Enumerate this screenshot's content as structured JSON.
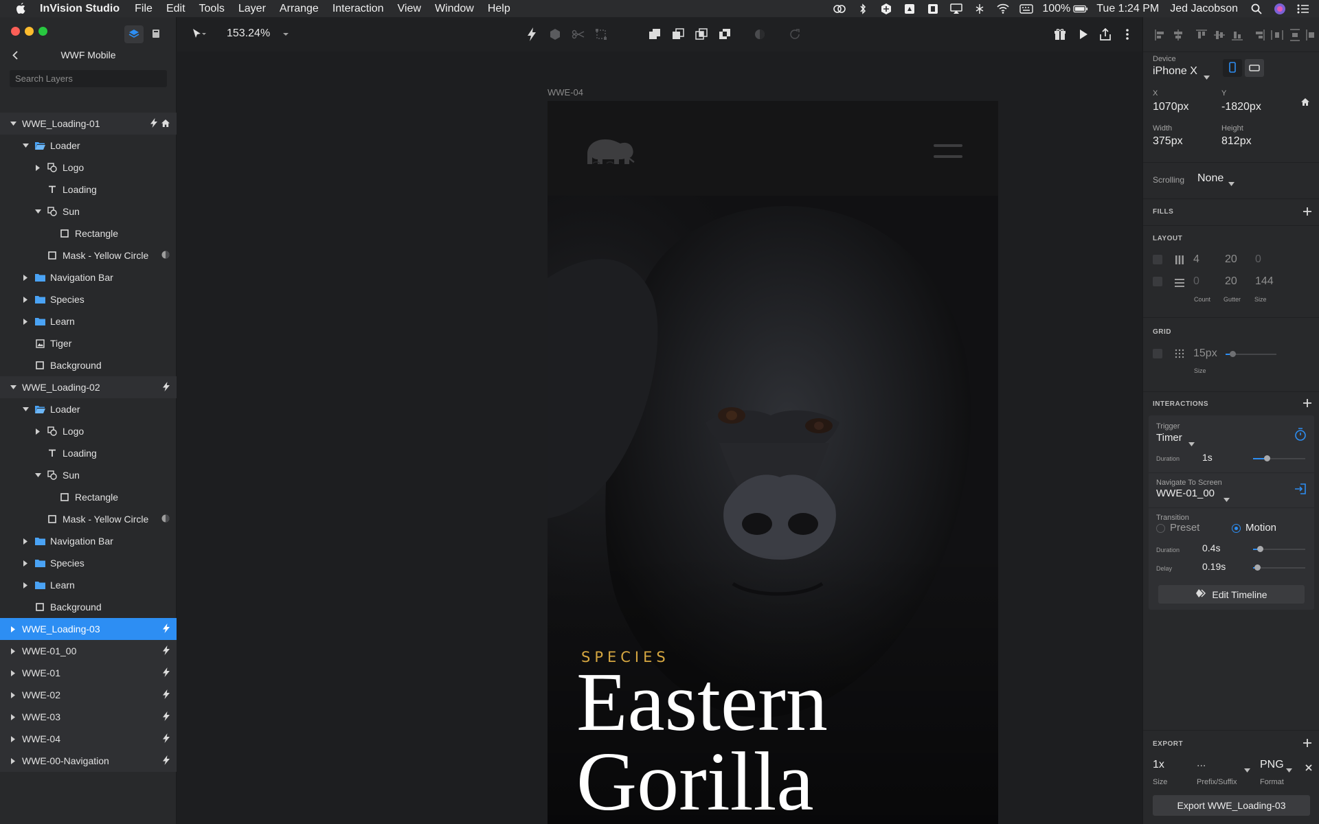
{
  "menubar": {
    "app_name": "InVision Studio",
    "items": [
      "File",
      "Edit",
      "Tools",
      "Layer",
      "Arrange",
      "Interaction",
      "View",
      "Window",
      "Help"
    ],
    "battery": "100%",
    "clock": "Tue 1:24 PM",
    "user": "Jed Jacobson"
  },
  "left_panel": {
    "project_title": "WWF Mobile",
    "search_placeholder": "Search Layers",
    "layers": [
      {
        "label": "WWE_Loading-01",
        "depth": 0,
        "arrow": "down",
        "type": "artboard",
        "badges": [
          "bolt",
          "home"
        ]
      },
      {
        "label": "Loader",
        "depth": 1,
        "arrow": "down",
        "type": "folder-open"
      },
      {
        "label": "Logo",
        "depth": 2,
        "arrow": "right",
        "type": "shape"
      },
      {
        "label": "Loading",
        "depth": 2,
        "arrow": "none",
        "type": "text"
      },
      {
        "label": "Sun",
        "depth": 2,
        "arrow": "down",
        "type": "shape"
      },
      {
        "label": "Rectangle",
        "depth": 3,
        "arrow": "none",
        "type": "rect"
      },
      {
        "label": "Mask - Yellow Circle",
        "depth": 2,
        "arrow": "none",
        "type": "rect",
        "badges": [
          "mask"
        ]
      },
      {
        "label": "Navigation Bar",
        "depth": 1,
        "arrow": "right",
        "type": "folder"
      },
      {
        "label": "Species",
        "depth": 1,
        "arrow": "right",
        "type": "folder"
      },
      {
        "label": "Learn",
        "depth": 1,
        "arrow": "right",
        "type": "folder"
      },
      {
        "label": "Tiger",
        "depth": 1,
        "arrow": "none",
        "type": "image"
      },
      {
        "label": "Background",
        "depth": 1,
        "arrow": "none",
        "type": "rect"
      },
      {
        "label": "WWE_Loading-02",
        "depth": 0,
        "arrow": "down",
        "type": "artboard",
        "badges": [
          "bolt"
        ]
      },
      {
        "label": "Loader",
        "depth": 1,
        "arrow": "down",
        "type": "folder-open"
      },
      {
        "label": "Logo",
        "depth": 2,
        "arrow": "right",
        "type": "shape"
      },
      {
        "label": "Loading",
        "depth": 2,
        "arrow": "none",
        "type": "text"
      },
      {
        "label": "Sun",
        "depth": 2,
        "arrow": "down",
        "type": "shape"
      },
      {
        "label": "Rectangle",
        "depth": 3,
        "arrow": "none",
        "type": "rect"
      },
      {
        "label": "Mask - Yellow Circle",
        "depth": 2,
        "arrow": "none",
        "type": "rect",
        "badges": [
          "mask"
        ]
      },
      {
        "label": "Navigation Bar",
        "depth": 1,
        "arrow": "right",
        "type": "folder"
      },
      {
        "label": "Species",
        "depth": 1,
        "arrow": "right",
        "type": "folder"
      },
      {
        "label": "Learn",
        "depth": 1,
        "arrow": "right",
        "type": "folder"
      },
      {
        "label": "Background",
        "depth": 1,
        "arrow": "none",
        "type": "rect"
      },
      {
        "label": "WWE_Loading-03",
        "depth": 0,
        "arrow": "right",
        "type": "artboard",
        "badges": [
          "bolt"
        ],
        "selected": true
      },
      {
        "label": "WWE-01_00",
        "depth": 0,
        "arrow": "right",
        "type": "artboard",
        "badges": [
          "bolt"
        ]
      },
      {
        "label": "WWE-01",
        "depth": 0,
        "arrow": "right",
        "type": "artboard",
        "badges": [
          "bolt"
        ]
      },
      {
        "label": "WWE-02",
        "depth": 0,
        "arrow": "right",
        "type": "artboard",
        "badges": [
          "bolt"
        ]
      },
      {
        "label": "WWE-03",
        "depth": 0,
        "arrow": "right",
        "type": "artboard",
        "badges": [
          "bolt"
        ]
      },
      {
        "label": "WWE-04",
        "depth": 0,
        "arrow": "right",
        "type": "artboard",
        "badges": [
          "bolt"
        ]
      },
      {
        "label": "WWE-00-Navigation",
        "depth": 0,
        "arrow": "right",
        "type": "artboard",
        "badges": [
          "bolt"
        ]
      }
    ]
  },
  "toolbar": {
    "zoom": "153.24%"
  },
  "canvas": {
    "artboard_name": "WWE-04",
    "species_label": "SPECIES",
    "species_name": "Eastern\nGorilla"
  },
  "inspector": {
    "device_label": "Device",
    "device_value": "iPhone X",
    "x_label": "X",
    "x_value": "1070px",
    "y_label": "Y",
    "y_value": "-1820px",
    "width_label": "Width",
    "width_value": "375px",
    "height_label": "Height",
    "height_value": "812px",
    "scrolling_label": "Scrolling",
    "scrolling_value": "None",
    "fills_title": "FILLS",
    "layout_title": "LAYOUT",
    "layout_columns": {
      "count": "4",
      "gutter": "20",
      "size": "0"
    },
    "layout_rows": {
      "count": "0",
      "gutter": "20",
      "size": "144"
    },
    "layout_headers": {
      "count": "Count",
      "gutter": "Gutter",
      "size": "Size"
    },
    "grid_title": "GRID",
    "grid_value": "15px",
    "grid_size_label": "Size",
    "interactions_title": "INTERACTIONS",
    "trigger_label": "Trigger",
    "trigger_value": "Timer",
    "trigger_duration_label": "Duration",
    "trigger_duration_value": "1s",
    "navigate_label": "Navigate To Screen",
    "navigate_value": "WWE-01_00",
    "transition_label": "Transition",
    "transition_preset": "Preset",
    "transition_motion": "Motion",
    "transition_duration_label": "Duration",
    "transition_duration_value": "0.4s",
    "delay_label": "Delay",
    "delay_value": "0.19s",
    "edit_timeline": "Edit Timeline",
    "export_title": "EXPORT",
    "export_size": "1x",
    "export_prefix": "...",
    "export_format": "PNG",
    "export_size_label": "Size",
    "export_prefix_label": "Prefix/Suffix",
    "export_format_label": "Format",
    "export_button": "Export WWE_Loading-03"
  },
  "colors": {
    "accent": "#2d8ef3",
    "species_gold": "#d6a741",
    "panel_bg": "#28292b",
    "canvas_bg": "#1d1e20"
  }
}
